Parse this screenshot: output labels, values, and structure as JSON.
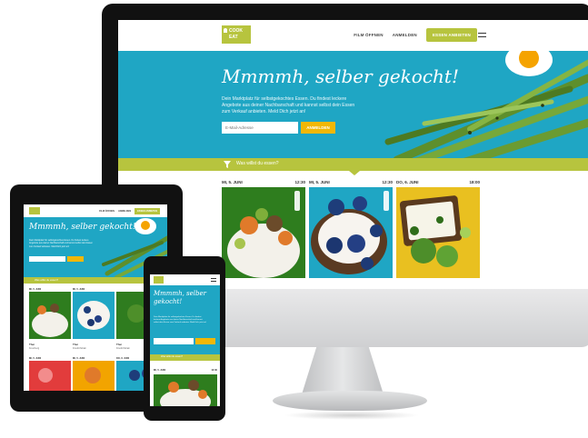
{
  "brand": {
    "line1": "COOK",
    "line2": "EAT"
  },
  "nav": {
    "items": [
      "FILM ÖFFNEN",
      "ANMELDEN"
    ],
    "cta": "ESSEN ANBIETEN"
  },
  "hero": {
    "title": "Mmmmh, selber gekocht!",
    "text": "Dein Marktplatz für selbstgekochtes Essen. Du findest leckere Angebote aus deiner Nachbarschaft und kannst selbst dein Essen zum Verkauf anbieten. Meld Dich jetzt an!",
    "email_placeholder": "E-Mail-Adresse",
    "button": "ANMELDEN"
  },
  "search": {
    "label": "Was willst du essen?"
  },
  "cards": [
    {
      "day": "MI, 5. JUNI",
      "time": "12:30"
    },
    {
      "day": "MI, 5. JUNI",
      "time": "12:30"
    },
    {
      "day": "DO, 6. JUNI",
      "time": "18:00"
    }
  ],
  "tablet": {
    "title": "Mmmmh, selber gekocht!",
    "search_label": "Was willst du essen?",
    "card_labels": [
      {
        "title": "Thai",
        "sub": "Kreuzberg"
      },
      {
        "title": "Thai",
        "sub": "Friedrichshain"
      },
      {
        "title": "Thai",
        "sub": "Friedrichshain"
      }
    ],
    "row2_days": [
      "MI, 5. JUNI",
      "MI, 5. JUNI",
      "DO, 6. JUNI"
    ]
  },
  "phone": {
    "title": "Mmmmh, selber gekocht!",
    "search_label": "Was willst du essen?",
    "card_day": "MI, 5. JUNI",
    "card_time": "12:30"
  },
  "colors": {
    "accent_green": "#b7c43e",
    "hero_blue": "#1fa6c4",
    "button_yellow": "#f2b705"
  }
}
